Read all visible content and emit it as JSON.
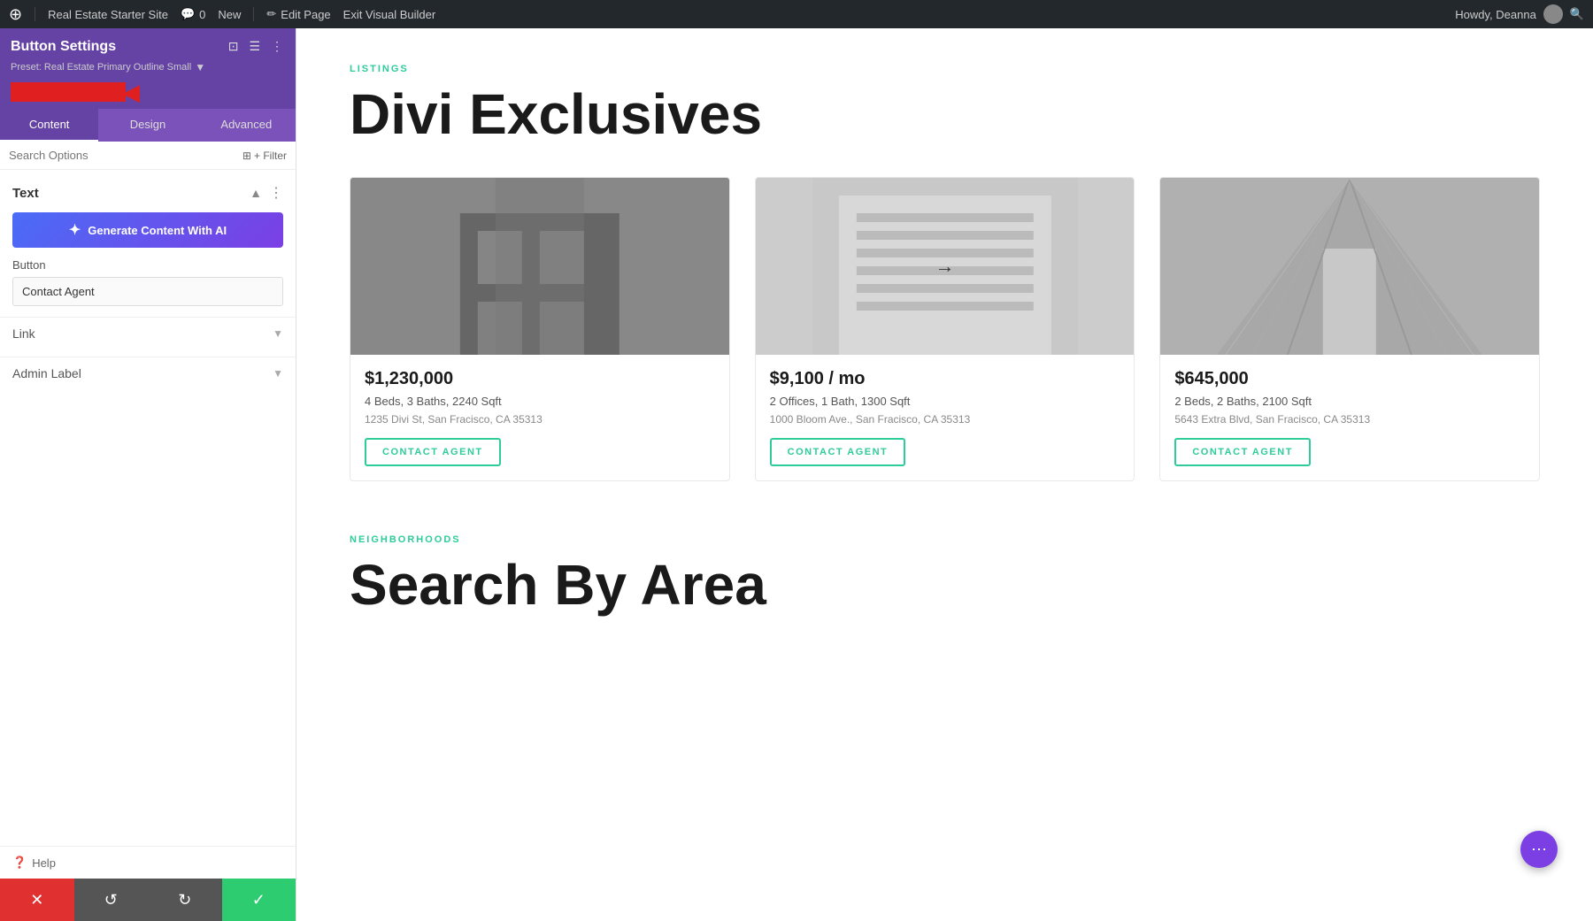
{
  "topbar": {
    "wp_icon": "⊕",
    "site_name": "Real Estate Starter Site",
    "comments": "0",
    "new_label": "New",
    "edit_page": "Edit Page",
    "exit_builder": "Exit Visual Builder",
    "howdy": "Howdy, Deanna"
  },
  "sidebar": {
    "title": "Button Settings",
    "preset_label": "Preset: Real Estate Primary Outline Small",
    "icons": [
      "⊡",
      "☰",
      "⋮"
    ],
    "tabs": [
      {
        "id": "content",
        "label": "Content",
        "active": true
      },
      {
        "id": "design",
        "label": "Design",
        "active": false
      },
      {
        "id": "advanced",
        "label": "Advanced",
        "active": false
      }
    ],
    "search_placeholder": "Search Options",
    "filter_label": "+ Filter",
    "text_section": {
      "label": "Text",
      "ai_btn_label": "Generate Content With AI"
    },
    "button_section": {
      "label": "Button",
      "value": "Contact Agent"
    },
    "link_section": {
      "label": "Link"
    },
    "admin_label_section": {
      "label": "Admin Label"
    },
    "help_label": "Help"
  },
  "bottom_bar": {
    "cancel_icon": "✕",
    "undo_icon": "↺",
    "redo_icon": "↻",
    "save_icon": "✓"
  },
  "main": {
    "listings": {
      "tag": "LISTINGS",
      "heading": "Divi Exclusives",
      "cards": [
        {
          "price": "$1,230,000",
          "details": "4 Beds, 3 Baths, 2240 Sqft",
          "address": "1235 Divi St, San Fracisco, CA 35313",
          "btn_label": "CONTACT AGENT",
          "img_type": "building1"
        },
        {
          "price": "$9,100 / mo",
          "details": "2 Offices, 1 Bath, 1300 Sqft",
          "address": "1000 Bloom Ave., San Fracisco, CA 35313",
          "btn_label": "CONTACT AGENT",
          "img_type": "building2"
        },
        {
          "price": "$645,000",
          "details": "2 Beds, 2 Baths, 2100 Sqft",
          "address": "5643 Extra Blvd, San Fracisco, CA 35313",
          "btn_label": "CONTACT AGENT",
          "img_type": "building3"
        }
      ]
    },
    "neighborhoods": {
      "tag": "NEIGHBORHOODS",
      "heading": "Search By Area"
    }
  },
  "floating": {
    "icon": "⋯"
  }
}
